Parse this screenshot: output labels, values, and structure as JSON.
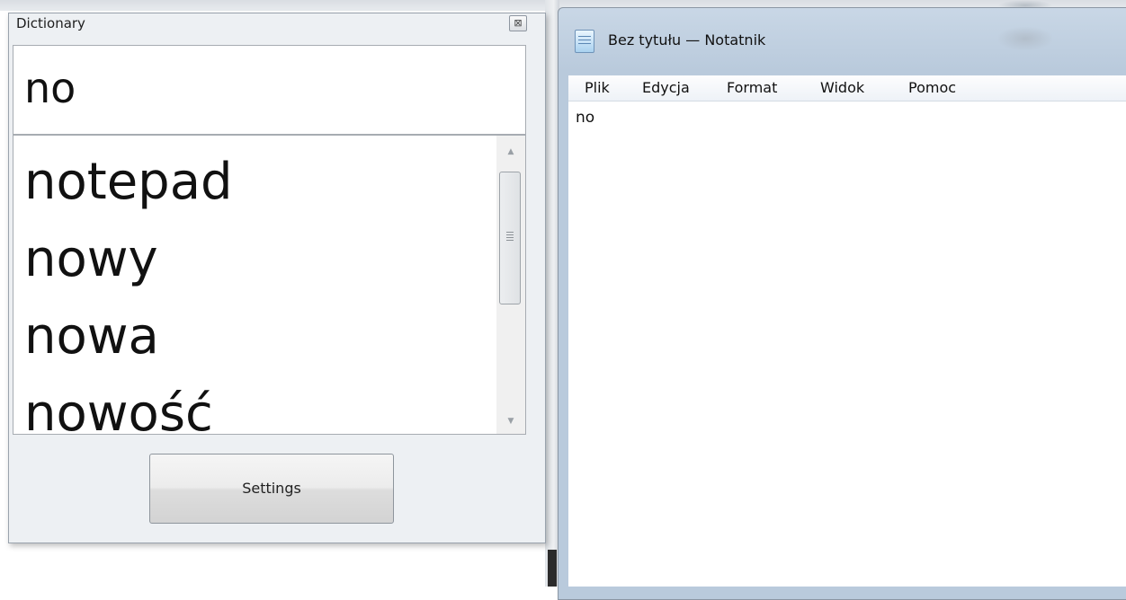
{
  "dictionary": {
    "title": "Dictionary",
    "close_glyph": "⊠",
    "input_value": "no",
    "suggestions": [
      "notepad",
      "nowy",
      "nowa",
      "nowość"
    ],
    "scroll_up_glyph": "▲",
    "scroll_down_glyph": "▼",
    "settings_label": "Settings"
  },
  "notepad": {
    "title": "Bez tytułu — Notatnik",
    "menu": [
      "Plik",
      "Edycja",
      "Format",
      "Widok",
      "Pomoc"
    ],
    "text": "no"
  }
}
